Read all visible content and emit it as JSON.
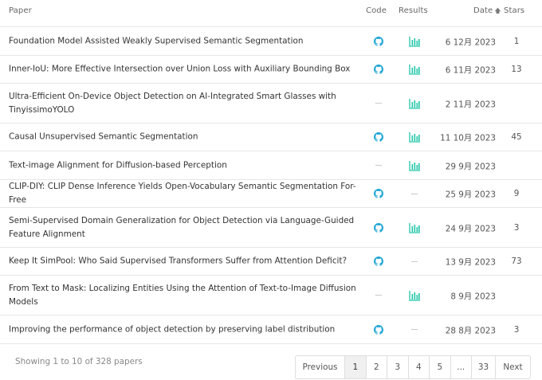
{
  "header": {
    "paper": "Paper",
    "code": "Code",
    "results": "Results",
    "date": "Date",
    "date_sort_icon": "arrow-up-icon",
    "stars": "Stars"
  },
  "icons": {
    "code_icon": "github-icon",
    "results_icon": "bar-chart-icon",
    "code_color": "#21a6d4",
    "results_color": "#21c5a8",
    "dash_color": "#c9c9c9"
  },
  "papers": [
    {
      "title": "Foundation Model Assisted Weakly Supervised Semantic Segmentation",
      "date": "6 12月 2023",
      "stars": "1",
      "has_code": true,
      "has_results": true
    },
    {
      "title": "Inner-IoU: More Effective Intersection over Union Loss with Auxiliary Bounding Box",
      "date": "6 11月 2023",
      "stars": "13",
      "has_code": true,
      "has_results": true
    },
    {
      "title": "Ultra-Efficient On-Device Object Detection on AI-Integrated Smart Glasses with TinyissimoYOLO",
      "date": "2 11月 2023",
      "stars": "",
      "has_code": false,
      "has_results": true
    },
    {
      "title": "Causal Unsupervised Semantic Segmentation",
      "date": "11 10月 2023",
      "stars": "45",
      "has_code": true,
      "has_results": true
    },
    {
      "title": "Text-image Alignment for Diffusion-based Perception",
      "date": "29 9月 2023",
      "stars": "",
      "has_code": false,
      "has_results": true
    },
    {
      "title": "CLIP-DIY: CLIP Dense Inference Yields Open-Vocabulary Semantic Segmentation For-Free",
      "date": "25 9月 2023",
      "stars": "9",
      "has_code": true,
      "has_results": false
    },
    {
      "title": "Semi-Supervised Domain Generalization for Object Detection via Language-Guided Feature Alignment",
      "date": "24 9月 2023",
      "stars": "3",
      "has_code": true,
      "has_results": true
    },
    {
      "title": "Keep It SimPool: Who Said Supervised Transformers Suffer from Attention Deficit?",
      "date": "13 9月 2023",
      "stars": "73",
      "has_code": true,
      "has_results": false
    },
    {
      "title": "From Text to Mask: Localizing Entities Using the Attention of Text-to-Image Diffusion Models",
      "date": "8 9月 2023",
      "stars": "",
      "has_code": false,
      "has_results": true
    },
    {
      "title": "Improving the performance of object detection by preserving label distribution",
      "date": "28 8月 2023",
      "stars": "3",
      "has_code": true,
      "has_results": false
    }
  ],
  "footer": {
    "showing": "Showing 1 to 10 of 328 papers"
  },
  "pagination": {
    "previous": "Previous",
    "pages": [
      "1",
      "2",
      "3",
      "4",
      "5",
      "...",
      "33"
    ],
    "active_page": "1",
    "next": "Next"
  }
}
